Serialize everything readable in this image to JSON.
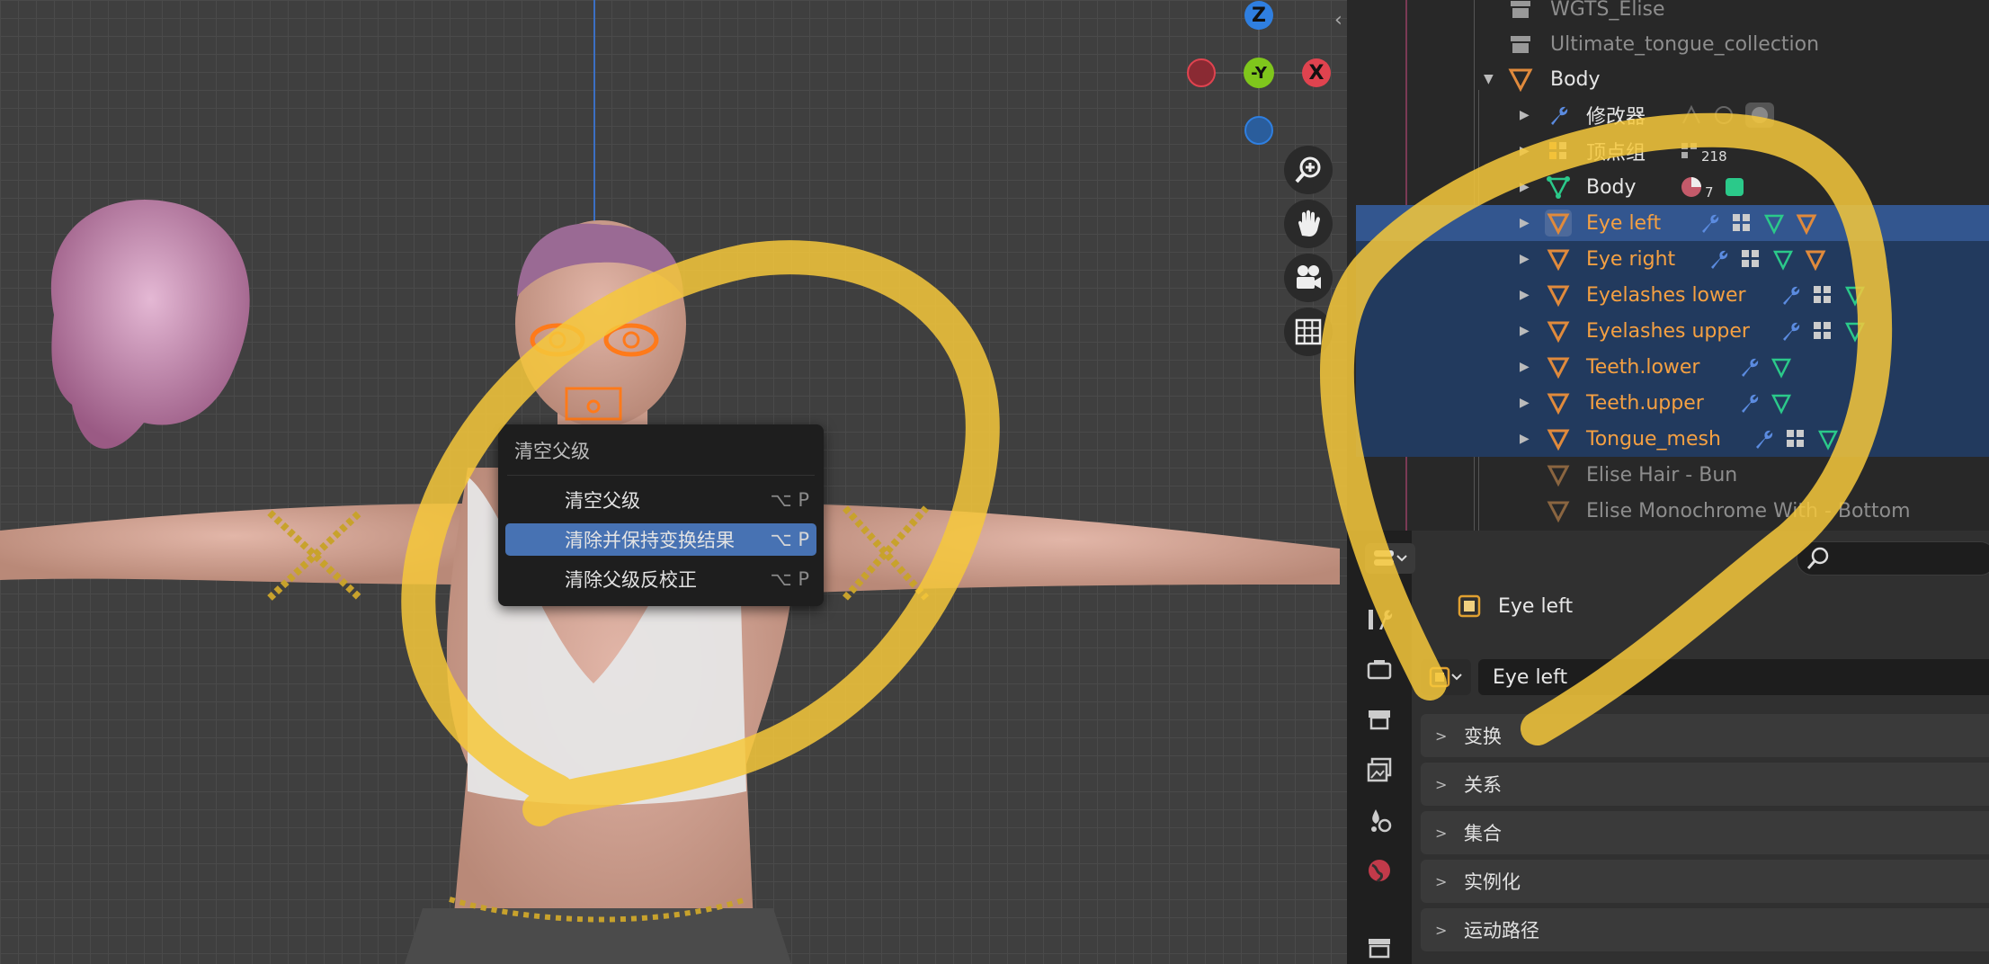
{
  "colors": {
    "active_row": "#33568f",
    "selected_row": "#223a5e",
    "menu_highlight": "#4772b3",
    "selected_object_text": "#f5a042",
    "annotation": "#f6c83b",
    "axis_x": "#e0434f",
    "axis_y": "#7fc61c",
    "axis_z": "#2f7fe0"
  },
  "gizmo": {
    "z": "Z",
    "y": "-Y",
    "x": "X"
  },
  "viewport_tools": [
    {
      "icon": "zoom-icon"
    },
    {
      "icon": "hand-pan-icon"
    },
    {
      "icon": "camera-icon"
    },
    {
      "icon": "grid-icon"
    }
  ],
  "context_menu": {
    "title": "清空父级",
    "items": [
      {
        "label": "清空父级",
        "shortcut": "⌥ P"
      },
      {
        "label": "清除并保持变换结果",
        "shortcut": "⌥ P",
        "highlighted": true
      },
      {
        "label": "清除父级反校正",
        "shortcut": "⌥ P"
      }
    ]
  },
  "outliner": {
    "rows": [
      {
        "name": "WGTS_Elise",
        "icon": "collection-icon"
      },
      {
        "name": "Ultimate_tongue_collection",
        "icon": "collection-icon"
      },
      {
        "name": "Body",
        "icon": "mesh-object-icon"
      },
      {
        "name": "修改器",
        "icon": "wrench-icon"
      },
      {
        "name": "顶点组",
        "icon": "vertex-group-icon",
        "badge": "218"
      },
      {
        "name": "Body",
        "icon": "mesh-data-icon",
        "badge": "7"
      },
      {
        "name": "Eye left",
        "icon": "mesh-object-icon"
      },
      {
        "name": "Eye right",
        "icon": "mesh-object-icon"
      },
      {
        "name": "Eyelashes lower",
        "icon": "mesh-object-icon"
      },
      {
        "name": "Eyelashes upper",
        "icon": "mesh-object-icon"
      },
      {
        "name": "Teeth.lower",
        "icon": "mesh-object-icon"
      },
      {
        "name": "Teeth.upper",
        "icon": "mesh-object-icon"
      },
      {
        "name": "Tongue_mesh",
        "icon": "mesh-object-icon"
      },
      {
        "name": "Elise Hair - Bun",
        "icon": "mesh-object-icon"
      },
      {
        "name": "Elise Monochrome With - Bottom",
        "icon": "mesh-object-icon"
      }
    ]
  },
  "properties": {
    "object_title": "Eye left",
    "object_name_value": "Eye left",
    "panels": [
      "变换",
      "关系",
      "集合",
      "实例化",
      "运动路径"
    ]
  }
}
